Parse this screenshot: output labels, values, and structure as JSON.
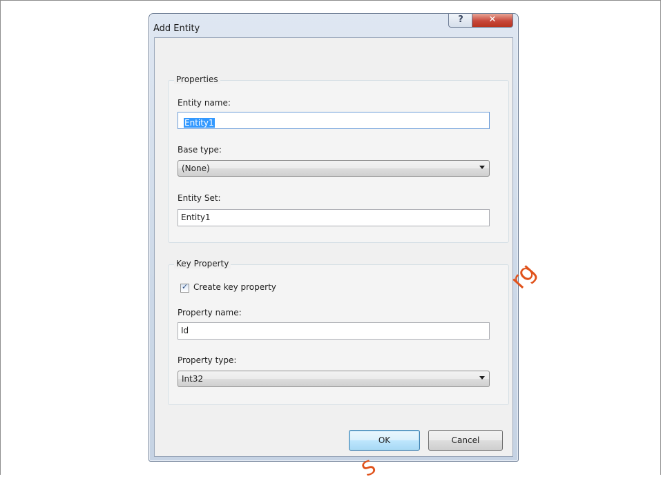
{
  "dialog": {
    "title": "Add Entity",
    "help_glyph": "?",
    "close_glyph": "✕"
  },
  "properties_group": {
    "title": "Properties",
    "entity_name_label": "Entity name:",
    "entity_name_value": "Entity1",
    "base_type_label": "Base type:",
    "base_type_value": "(None)",
    "entity_set_label": "Entity Set:",
    "entity_set_value": "Entity1"
  },
  "key_property_group": {
    "title": "Key Property",
    "create_key_label": "Create key property",
    "create_key_checked": true,
    "property_name_label": "Property name:",
    "property_name_value": "Id",
    "property_type_label": "Property type:",
    "property_type_value": "Int32"
  },
  "buttons": {
    "ok_label": "OK",
    "cancel_label": "Cancel"
  },
  "watermark": {
    "text_right": "rg",
    "text_bottom": "S"
  },
  "colors": {
    "selection": "#3399ff",
    "close_button": "#c7473a",
    "watermark": "#e0521b"
  }
}
